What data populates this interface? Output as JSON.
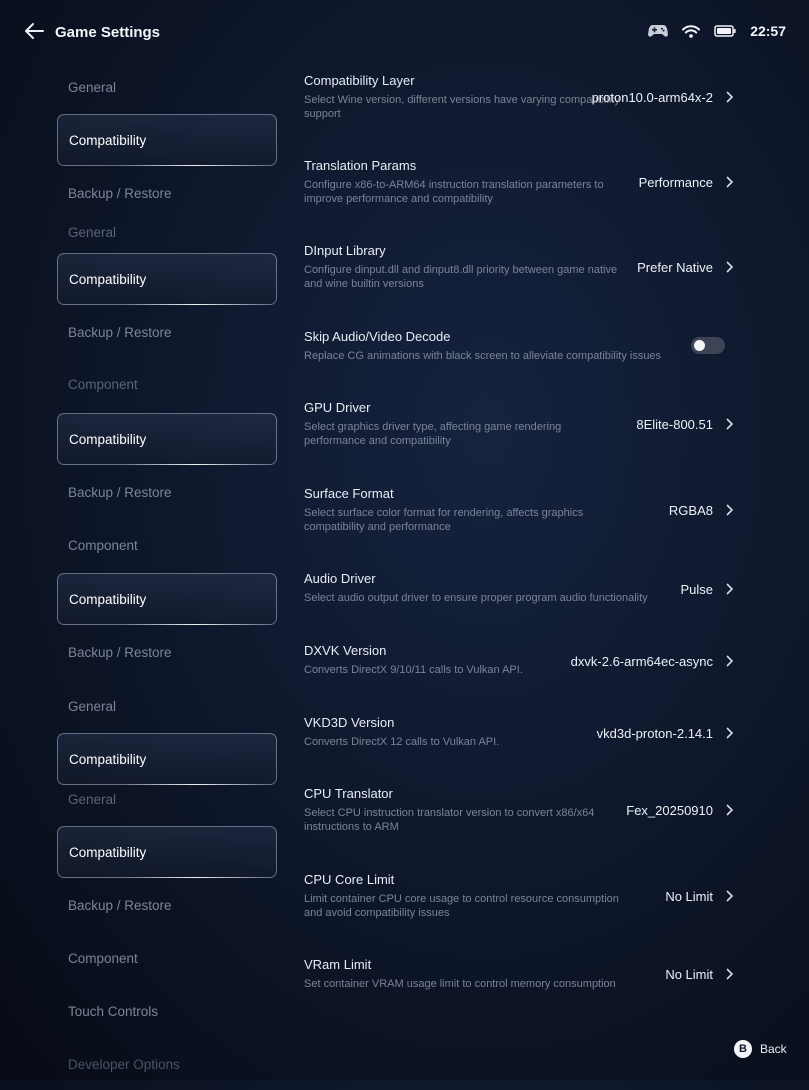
{
  "header": {
    "title": "Game Settings",
    "time": "22:57"
  },
  "sidebar": [
    {
      "label": "General",
      "state": "normal"
    },
    {
      "label": "Compatibility",
      "state": "selected"
    },
    {
      "label": "Backup / Restore",
      "state": "normal"
    },
    {
      "label": "General",
      "state": "ghost"
    },
    {
      "label": "Compatibility",
      "state": "selected"
    },
    {
      "label": "Backup / Restore",
      "state": "normal"
    },
    {
      "label": "Component",
      "state": "ghost"
    },
    {
      "label": "Compatibility",
      "state": "selected"
    },
    {
      "label": "Backup / Restore",
      "state": "normal"
    },
    {
      "label": "Component",
      "state": "normal"
    },
    {
      "label": "Compatibility",
      "state": "selected"
    },
    {
      "label": "Backup / Restore",
      "state": "normal"
    },
    {
      "label": "General",
      "state": "normal"
    },
    {
      "label": "Compatibility",
      "state": "selected"
    },
    {
      "label": "General",
      "state": "ghost"
    },
    {
      "label": "Compatibility",
      "state": "selected"
    },
    {
      "label": "Backup / Restore",
      "state": "normal"
    },
    {
      "label": "Component",
      "state": "normal"
    },
    {
      "label": "Touch Controls",
      "state": "normal"
    },
    {
      "label": "Developer Options",
      "state": "faded"
    }
  ],
  "settings": [
    {
      "title": "Compatibility Layer",
      "desc": "Select Wine version, different versions have varying compatibility support",
      "value": "proton10.0-arm64x-2"
    },
    {
      "title": "Translation Params",
      "desc": "Configure x86-to-ARM64 instruction translation parameters to improve performance and compatibility",
      "value": "Performance"
    },
    {
      "title": "DInput Library",
      "desc": "Configure dinput.dll and dinput8.dll priority between game native and wine builtin versions",
      "value": "Prefer Native"
    },
    {
      "title": "Skip Audio/Video Decode",
      "desc": "Replace CG animations with black screen to alleviate compatibility issues",
      "toggle": false
    },
    {
      "title": "GPU Driver",
      "desc": "Select graphics driver type, affecting game rendering performance and compatibility",
      "value": "8Elite-800.51"
    },
    {
      "title": "Surface Format",
      "desc": "Select surface color format for rendering, affects graphics compatibility and performance",
      "value": "RGBA8"
    },
    {
      "title": "Audio Driver",
      "desc": "Select audio output driver to ensure proper program audio functionality",
      "value": "Pulse"
    },
    {
      "title": "DXVK Version",
      "desc": "Converts DirectX 9/10/11 calls to Vulkan API.",
      "value": "dxvk-2.6-arm64ec-async"
    },
    {
      "title": "VKD3D Version",
      "desc": "Converts DirectX 12 calls to Vulkan API.",
      "value": "vkd3d-proton-2.14.1"
    },
    {
      "title": "CPU Translator",
      "desc": "Select CPU instruction translator version to convert x86/x64 instructions to ARM",
      "value": "Fex_20250910"
    },
    {
      "title": "CPU Core Limit",
      "desc": "Limit container CPU core usage to control resource consumption and avoid compatibility issues",
      "value": "No Limit"
    },
    {
      "title": "VRam Limit",
      "desc": "Set container VRAM usage limit to control memory consumption",
      "value": "No Limit"
    }
  ],
  "footer": {
    "back_key": "B",
    "back_label": "Back"
  }
}
